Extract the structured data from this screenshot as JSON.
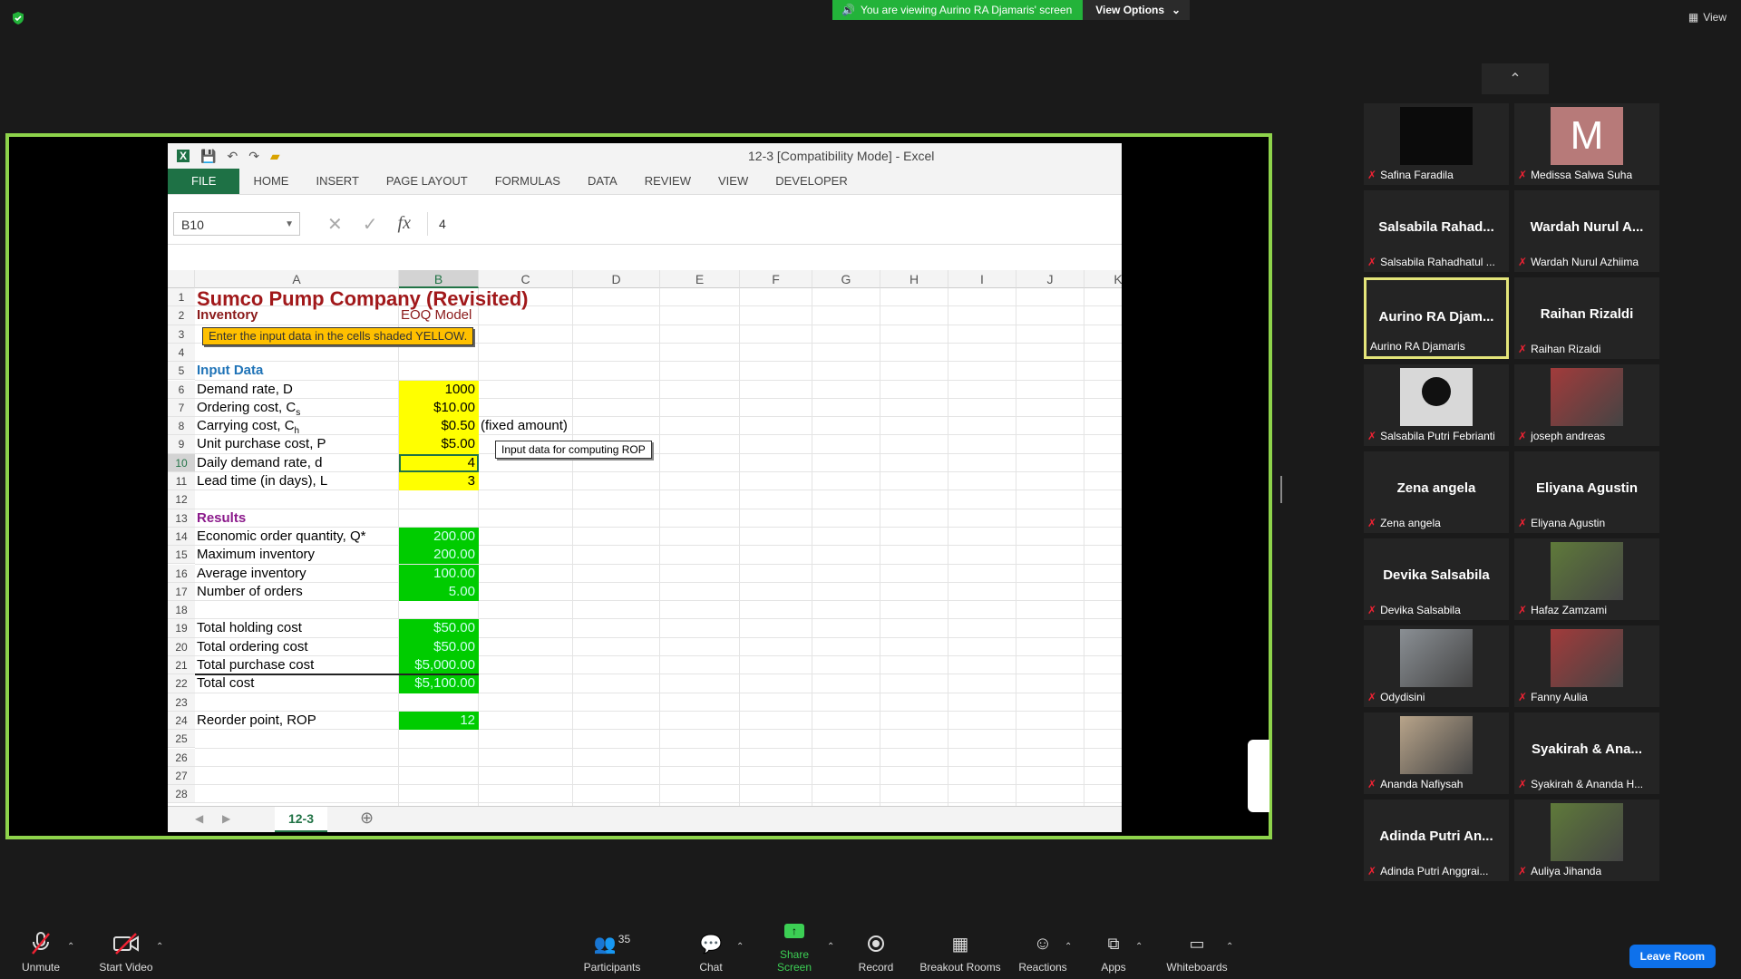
{
  "banner": {
    "message": "You are viewing Aurino RA Djamaris' screen",
    "options": "View Options"
  },
  "view_label": "View",
  "excel": {
    "doc_title": "12-3  [Compatibility Mode] - Excel",
    "ribbon_tabs": [
      "FILE",
      "HOME",
      "INSERT",
      "PAGE LAYOUT",
      "FORMULAS",
      "DATA",
      "REVIEW",
      "VIEW",
      "DEVELOPER"
    ],
    "name_box": "B10",
    "formula_value": "4",
    "columns": [
      "A",
      "B",
      "C",
      "D",
      "E",
      "F",
      "G",
      "H",
      "I",
      "J",
      "K"
    ],
    "rows": [
      "1",
      "2",
      "3",
      "4",
      "5",
      "6",
      "7",
      "8",
      "9",
      "10",
      "11",
      "12",
      "13",
      "14",
      "15",
      "16",
      "17",
      "18",
      "19",
      "20",
      "21",
      "22",
      "23",
      "24",
      "25",
      "26",
      "27",
      "28"
    ],
    "cells": {
      "title": "Sumco Pump Company (Revisited)",
      "inventory": "Inventory",
      "eoq_model": "EOQ Model",
      "note": "Enter the input data in the cells shaded YELLOW.",
      "input_data": "Input Data",
      "demand_label": "Demand rate, D",
      "demand_value": "1000",
      "ordering_label": "Ordering cost, C",
      "ordering_sub": "s",
      "ordering_value": "$10.00",
      "carrying_label": "Carrying cost, C",
      "carrying_sub": "h",
      "carrying_value": "$0.50",
      "carrying_note": "(fixed amount)",
      "unit_label": "Unit purchase cost, P",
      "unit_value": "$5.00",
      "daily_label": "Daily demand rate, d",
      "daily_value": "4",
      "lead_label": "Lead time (in days), L",
      "lead_value": "3",
      "comment": "Input data for computing ROP",
      "results": "Results",
      "eoq_label": "Economic order quantity, Q*",
      "eoq_value": "200.00",
      "max_label": "Maximum inventory",
      "max_value": "200.00",
      "avg_label": "Average inventory",
      "avg_value": "100.00",
      "num_label": "Number of orders",
      "num_value": "5.00",
      "hold_label": "Total holding cost",
      "hold_value": "$50.00",
      "order_label": "Total ordering cost",
      "order_value": "$50.00",
      "purchase_label": "Total purchase cost",
      "purchase_value": "$5,000.00",
      "total_label": "Total cost",
      "total_value": "$5,100.00",
      "rop_label": "Reorder point, ROP",
      "rop_value": "12"
    },
    "sheet_tab": "12-3"
  },
  "participants": [
    {
      "name": "Safina Faradila",
      "display": "",
      "kind": "dark"
    },
    {
      "name": "Medissa Salwa Suha",
      "display": "M",
      "kind": "letter"
    },
    {
      "name": "Salsabila Rahadhatul ...",
      "display": "Salsabila  Rahad...",
      "kind": "text"
    },
    {
      "name": "Wardah Nurul Azhiima",
      "display": "Wardah Nurul A...",
      "kind": "text"
    },
    {
      "name": "Aurino RA Djamaris",
      "display": "Aurino RA Djam...",
      "kind": "text"
    },
    {
      "name": "Raihan Rizaldi",
      "display": "Raihan Rizaldi",
      "kind": "text"
    },
    {
      "name": "Salsabila Putri Febrianti",
      "display": "",
      "kind": "avatar"
    },
    {
      "name": "joseph andreas",
      "display": "",
      "kind": "photo"
    },
    {
      "name": "Zena angela",
      "display": "Zena angela",
      "kind": "text"
    },
    {
      "name": "Eliyana Agustin",
      "display": "Eliyana Agustin",
      "kind": "text"
    },
    {
      "name": "Devika Salsabila",
      "display": "Devika Salsabila",
      "kind": "text"
    },
    {
      "name": "Hafaz Zamzami",
      "display": "",
      "kind": "photo"
    },
    {
      "name": "Odydisini",
      "display": "",
      "kind": "photo"
    },
    {
      "name": "Fanny Aulia",
      "display": "",
      "kind": "photo"
    },
    {
      "name": "Ananda Nafiysah",
      "display": "",
      "kind": "photo"
    },
    {
      "name": "Syakirah & Ananda H...",
      "display": "Syakirah & Ana...",
      "kind": "text"
    },
    {
      "name": "Adinda Putri Anggrai...",
      "display": "Adinda Putri An...",
      "kind": "text"
    },
    {
      "name": "Auliya Jihanda",
      "display": "",
      "kind": "photo"
    }
  ],
  "toolbar": {
    "unmute": "Unmute",
    "start_video": "Start Video",
    "participants": "Participants",
    "participants_count": "35",
    "chat": "Chat",
    "share_screen": "Share Screen",
    "record": "Record",
    "breakout": "Breakout Rooms",
    "reactions": "Reactions",
    "apps": "Apps",
    "whiteboards": "Whiteboards",
    "leave": "Leave Room"
  },
  "colors": {
    "accent_green": "#8ed34b",
    "share_green": "#23b33a",
    "leave_blue": "#0e71eb",
    "active_tile": "#e4e57a"
  }
}
